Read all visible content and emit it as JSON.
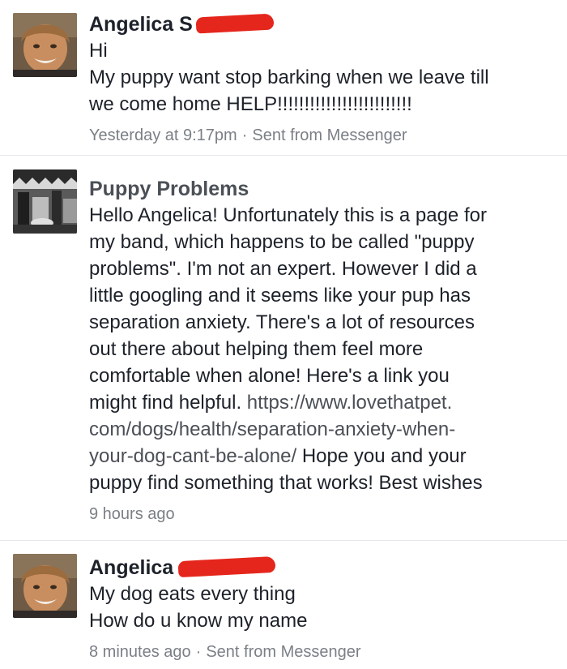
{
  "messages": [
    {
      "author": "Angelica S",
      "lines": [
        "Hi",
        "My puppy want stop barking when we leave till",
        "we come home HELP!!!!!!!!!!!!!!!!!!!!!!!!!"
      ],
      "timestamp": "Yesterday at 9:17pm",
      "separator": "·",
      "source": "Sent from Messenger"
    },
    {
      "author": "Puppy Problems",
      "lines": [
        "Hello Angelica! Unfortunately this is a page for",
        "my band, which happens to be called \"puppy",
        "problems\". I'm not an expert. However I did a",
        "little googling and it seems like your pup has",
        "separation anxiety. There's a lot of resources",
        "out there about helping them feel more",
        "comfortable when alone! Here's a link you"
      ],
      "line_before_link": "might find helpful. ",
      "link_line_1": "https://www.lovethatpet.",
      "link_line_2": "com/dogs/health/separation-anxiety-when-",
      "link_line_3": "your-dog-cant-be-alone/",
      "after_link": " Hope you and your",
      "closing_line": "puppy find something that works! Best wishes",
      "timestamp": "9 hours ago"
    },
    {
      "author": "Angelica",
      "lines": [
        "My dog eats every thing",
        "How do u know my name"
      ],
      "timestamp": "8 minutes ago",
      "separator": "·",
      "source": "Sent from Messenger"
    }
  ]
}
